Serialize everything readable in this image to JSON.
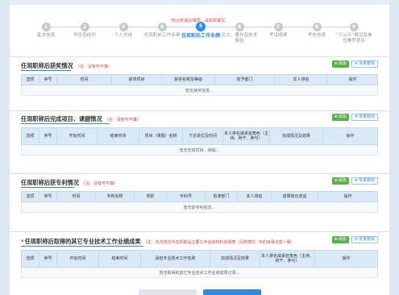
{
  "notice": "*标记的是必填项，请如实填写。",
  "steps": [
    {
      "num": "1",
      "label": "基本信息"
    },
    {
      "num": "2",
      "label": "学历及经历"
    },
    {
      "num": "3",
      "label": "个人总结"
    },
    {
      "num": "4",
      "label": "任现职前工作业绩"
    },
    {
      "num": "5",
      "label": "任现职后工作业绩"
    },
    {
      "num": "6",
      "label": "论文、著作及技术报告"
    },
    {
      "num": "7",
      "label": "考试成绩"
    },
    {
      "num": "8",
      "label": "考核信息"
    },
    {
      "num": "9",
      "label": "“三公示”情况及单位推荐意见"
    }
  ],
  "active_step": 5,
  "buttons": {
    "add": "添加",
    "delete": "批量删除"
  },
  "sections": [
    {
      "title": "任现职称后获奖情况",
      "note": "（注：没有可不填）",
      "columns": [
        "选项",
        "序号",
        "时间",
        "获奖项目",
        "获奖名称及等级",
        "授予部门",
        "本人排名",
        "操作"
      ],
      "empty": "暂无获奖信息..."
    },
    {
      "title": "任现职称后完成项目、课题情况",
      "note": "（注：没有可不填）",
      "columns": [
        "选项",
        "序号",
        "开始时间",
        "结束时间",
        "项目（课题）名称",
        "下达单位及时间",
        "本人排名或承担角色（主持、骨干、参与）",
        "完成情况及效果",
        "操作"
      ],
      "empty": "暂无完成项目、课题..."
    },
    {
      "title": "任现职称后获专利情况",
      "note": "（注：没有可不填）",
      "columns": [
        "选项",
        "序号",
        "时间",
        "专利名称",
        "类别",
        "专利号",
        "批准部门",
        "本人排名",
        "成果转化收益",
        "操作"
      ],
      "empty": "暂无获专利信息..."
    },
    {
      "title": "任现职称后取得的其它专业技术工作业绩成果",
      "note": "（注：本内容应与任现职后主要工作业绩材料目录表（见附表3）中的目录内容一致）",
      "required": true,
      "columns": [
        "选项",
        "序号",
        "开始时间",
        "结束时间",
        "承担专业技术工作名称",
        "完成情况及效果",
        "本人排名或承担角色（主持、骨干、参与）",
        "操作"
      ],
      "empty": "暂无取得的其它专业技术工作业绩成果记录..."
    }
  ],
  "colors": {
    "accent": "#2f8ae0",
    "add_button": "#58b24a",
    "note": "#e03b3b"
  }
}
